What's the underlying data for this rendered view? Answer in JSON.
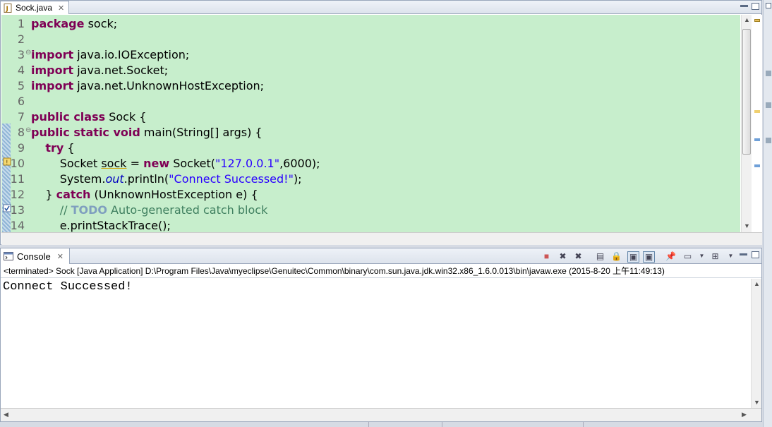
{
  "editor": {
    "tab_label": "Sock.java",
    "tab_close": "✕",
    "lines": [
      {
        "n": "1",
        "html": "<span class='kw'>package</span> sock;"
      },
      {
        "n": "2",
        "html": ""
      },
      {
        "n": "3",
        "html": "<span class='kw'>import</span> java.io.IOException;"
      },
      {
        "n": "4",
        "html": "<span class='kw'>import</span> java.net.Socket;"
      },
      {
        "n": "5",
        "html": "<span class='kw'>import</span> java.net.UnknownHostException;"
      },
      {
        "n": "6",
        "html": ""
      },
      {
        "n": "7",
        "html": "<span class='kw'>public class</span> Sock {"
      },
      {
        "n": "8",
        "html": "<span class='kw'>public static void</span> main(String[] args) {"
      },
      {
        "n": "9",
        "html": "    <span class='kw'>try</span> {"
      },
      {
        "n": "10",
        "html": "        Socket <u style='text-decoration-color:#d0a000'>sock</u> = <span class='kw'>new</span> Socket(<span class='str'>\"127.0.0.1\"</span>,6000);"
      },
      {
        "n": "11",
        "html": "        System.<span class='fld'>out</span>.println(<span class='str'>\"Connect Successed!\"</span>);"
      },
      {
        "n": "12",
        "html": "    } <span class='kw'>catch</span> (UnknownHostException e) {"
      },
      {
        "n": "13",
        "html": "        <span class='cm'>// <span class='todo'>TODO</span> Auto-generated catch block</span>"
      },
      {
        "n": "14",
        "html": "        e.printStackTrace();"
      }
    ]
  },
  "console": {
    "tab_label": "Console",
    "tab_close": "✕",
    "status": "<terminated> Sock [Java Application] D:\\Program Files\\Java\\myeclipse\\Genuitec\\Common\\binary\\com.sun.java.jdk.win32.x86_1.6.0.013\\bin\\javaw.exe (2015-8-20 上午11:49:13)",
    "output": "Connect Successed!"
  },
  "colors": {
    "code_background": "#c7eecc",
    "keyword": "#7f0055",
    "string": "#2a00ff",
    "comment": "#3f7f5f"
  }
}
